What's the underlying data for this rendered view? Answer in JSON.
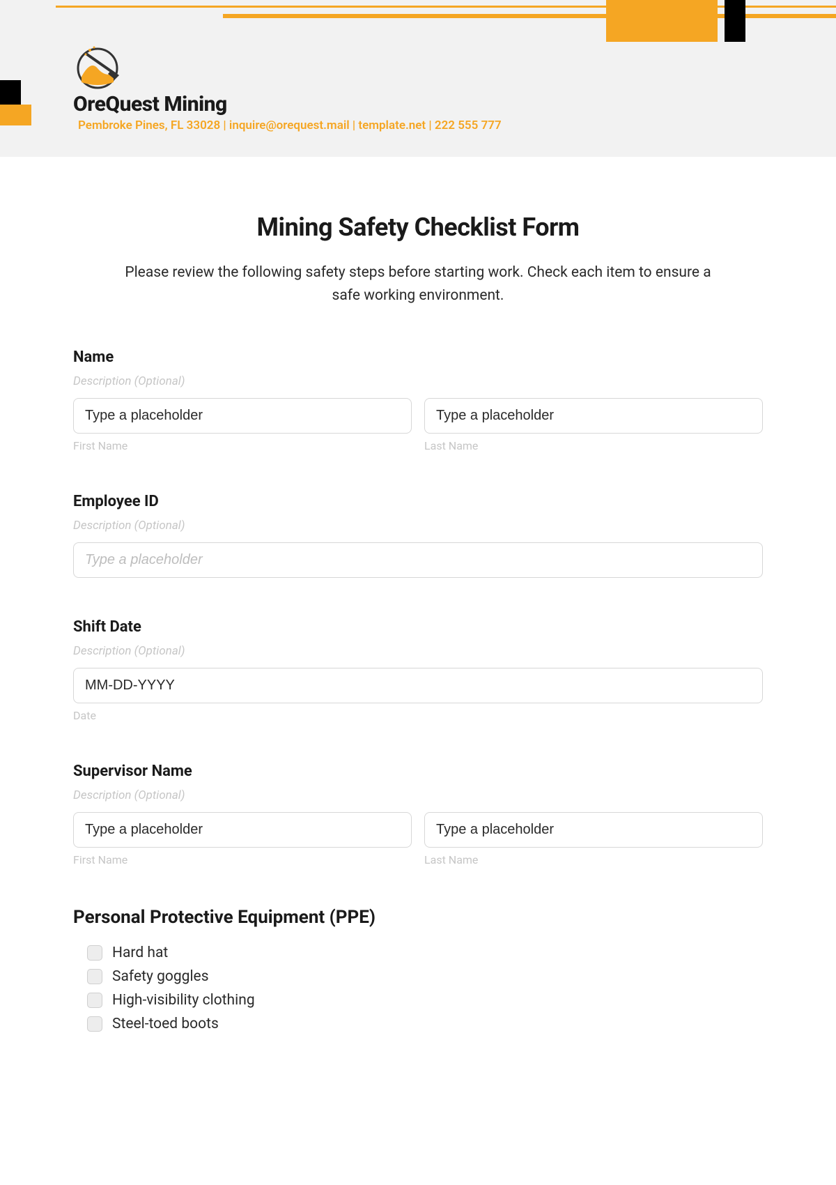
{
  "header": {
    "company": "OreQuest Mining",
    "info": "Pembroke Pines, FL 33028 | inquire@orequest.mail | template.net | 222 555 777"
  },
  "form": {
    "title": "Mining Safety Checklist Form",
    "intro": "Please review the following safety steps before starting work. Check each item to ensure a safe working environment.",
    "desc_hint": "Description (Optional)",
    "placeholder_text": "Type a placeholder",
    "first_name_label": "First Name",
    "last_name_label": "Last Name",
    "date_label": "Date",
    "groups": {
      "name": {
        "label": "Name"
      },
      "employee_id": {
        "label": "Employee ID",
        "placeholder": "Type a placeholder"
      },
      "shift_date": {
        "label": "Shift Date",
        "placeholder": "MM-DD-YYYY"
      },
      "supervisor": {
        "label": "Supervisor Name"
      }
    },
    "ppe": {
      "heading": "Personal Protective Equipment (PPE)",
      "items": [
        "Hard hat",
        "Safety goggles",
        "High-visibility clothing",
        "Steel-toed boots"
      ]
    }
  }
}
